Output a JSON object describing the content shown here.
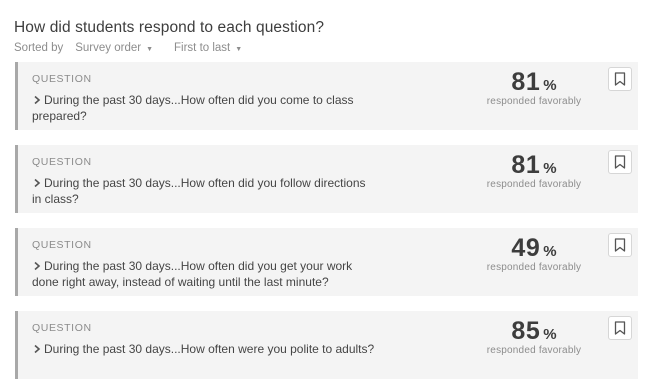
{
  "header": {
    "title": "How did students respond to each question?",
    "sorted_by_label": "Sorted by",
    "sort_option": "Survey order",
    "order_option": "First to last"
  },
  "questions": [
    {
      "label": "QUESTION",
      "text": "During the past 30 days...How often did you come to class prepared?",
      "percent": "81",
      "percent_sign": "%",
      "caption": "responded favorably"
    },
    {
      "label": "QUESTION",
      "text": "During the past 30 days...How often did you follow directions in class?",
      "percent": "81",
      "percent_sign": "%",
      "caption": "responded favorably"
    },
    {
      "label": "QUESTION",
      "text": "During the past 30 days...How often did you get your work done right away, instead of waiting until the last minute?",
      "percent": "49",
      "percent_sign": "%",
      "caption": "responded favorably"
    },
    {
      "label": "QUESTION",
      "text": "During the past 30 days...How often were you polite to adults?",
      "percent": "85",
      "percent_sign": "%",
      "caption": "responded favorably"
    }
  ],
  "icons": {
    "expand": "chevron-right-icon",
    "bookmark": "bookmark-icon",
    "dropdown": "caret-down-icon"
  },
  "colors": {
    "card_background": "#f4f4f4",
    "card_accent": "#a8a8a8",
    "text_primary": "#3d3d3d",
    "text_muted": "#8d8d8d"
  }
}
